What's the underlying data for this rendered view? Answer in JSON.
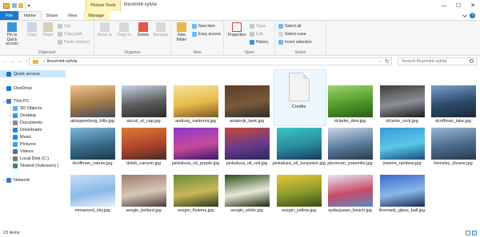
{
  "window": {
    "title": "linuxmint-sylvia",
    "context_tab": "Picture Tools",
    "controls": [
      "—",
      "☐",
      "✕"
    ]
  },
  "ribbon_tabs": [
    "File",
    "Home",
    "Share",
    "View",
    "Manage"
  ],
  "ribbon": {
    "clipboard": {
      "label": "Clipboard",
      "pin": "Pin to Quick access",
      "copy": "Copy",
      "paste": "Paste",
      "cut": "Cut",
      "copy_path": "Copy path",
      "paste_shortcut": "Paste shortcut"
    },
    "organize": {
      "label": "Organize",
      "move_to": "Move to",
      "copy_to": "Copy to",
      "delete": "Delete",
      "rename": "Rename"
    },
    "new": {
      "label": "New",
      "new_folder": "New folder",
      "new_item": "New item",
      "easy_access": "Easy access"
    },
    "open": {
      "label": "Open",
      "properties": "Properties",
      "open": "Open",
      "edit": "Edit",
      "history": "History"
    },
    "select": {
      "label": "Select",
      "select_all": "Select all",
      "select_none": "Select none",
      "invert": "Invert selection"
    }
  },
  "address": {
    "path": "linuxmint-sylvia",
    "search_placeholder": "Search linuxmint-sylvia"
  },
  "nav": [
    {
      "label": "Quick access",
      "color": "#1979ca",
      "indent": 0,
      "selected": true,
      "expand": "›"
    },
    {
      "label": "OneDrive",
      "color": "#1979ca",
      "indent": 0,
      "selected": false,
      "expand": "›"
    },
    {
      "label": "This PC",
      "color": "#3a7bbf",
      "indent": 0,
      "selected": false,
      "expand": "⌄"
    },
    {
      "label": "3D Objects",
      "color": "#6aa6e0",
      "indent": 1,
      "selected": false,
      "expand": "›"
    },
    {
      "label": "Desktop",
      "color": "#3c94d8",
      "indent": 1,
      "selected": false,
      "expand": "›"
    },
    {
      "label": "Documents",
      "color": "#8a8a8a",
      "indent": 1,
      "selected": false,
      "expand": "›"
    },
    {
      "label": "Downloads",
      "color": "#1e88d8",
      "indent": 1,
      "selected": false,
      "expand": "›"
    },
    {
      "label": "Music",
      "color": "#1e88d8",
      "indent": 1,
      "selected": false,
      "expand": "›"
    },
    {
      "label": "Pictures",
      "color": "#3aa0e6",
      "indent": 1,
      "selected": false,
      "expand": "›"
    },
    {
      "label": "Videos",
      "color": "#5a6e85",
      "indent": 1,
      "selected": false,
      "expand": "›"
    },
    {
      "label": "Local Disk (C:)",
      "color": "#6d7a88",
      "indent": 1,
      "selected": false,
      "expand": "›"
    },
    {
      "label": "Shared (\\\\vboxsrv) (",
      "color": "#3d8a3d",
      "indent": 1,
      "selected": false,
      "expand": "›"
    },
    {
      "label": "Network",
      "color": "#3a7bbf",
      "indent": 0,
      "selected": false,
      "expand": "›"
    }
  ],
  "files": [
    {
      "name": "akloppenburg_hills.jpg",
      "colors": [
        "#f2c48a",
        "#a37a4a",
        "#3e4b5a"
      ]
    },
    {
      "name": "akcoil_el_cap.jpg",
      "colors": [
        "#c8d6e6",
        "#5b5b5b",
        "#2a2a2a"
      ]
    },
    {
      "name": "andrzej_santorini.jpg",
      "colors": [
        "#f3e39a",
        "#e8b84a",
        "#7a5a2a"
      ]
    },
    {
      "name": "aviatorjk_bark.jpg",
      "colors": [
        "#5a3c2a",
        "#7a5a3a",
        "#2c2c2c"
      ]
    },
    {
      "name": "Credits",
      "colors": [],
      "doc": true
    },
    {
      "name": "dclarke_dew.jpg",
      "colors": [
        "#9ed36a",
        "#4f9a2a",
        "#2a5a1a"
      ]
    },
    {
      "name": "dclarke_rock.jpg",
      "colors": [
        "#3d3d3d",
        "#8a8f96",
        "#1a1a1a"
      ]
    },
    {
      "name": "dcoffman_lake.jpg",
      "colors": [
        "#7aa0c8",
        "#2c4a6a",
        "#1a2838"
      ]
    },
    {
      "name": "dcoffman_nature.jpg",
      "colors": [
        "#7fb8d8",
        "#3a6a8a",
        "#1a3a4a"
      ]
    },
    {
      "name": "dolah_canyon.jpg",
      "colors": [
        "#e07a3a",
        "#b0452a",
        "#4a2a2a"
      ]
    },
    {
      "name": "jankaluza_oil_purple.jpg",
      "colors": [
        "#8a3ac8",
        "#c84a9a",
        "#3a1a6a"
      ]
    },
    {
      "name": "jankaluza_oil_red.jpg",
      "colors": [
        "#c84a3a",
        "#6a3a8a",
        "#2a2a5a"
      ]
    },
    {
      "name": "jankaluza_oil_turquoise.jpg",
      "colors": [
        "#3ac8c0",
        "#2a8aa0",
        "#1a3a5a"
      ]
    },
    {
      "name": "jdonovan_yosemite.jpg",
      "colors": [
        "#c8d8e8",
        "#5a7a9a",
        "#2a3a4a"
      ]
    },
    {
      "name": "jowens_rainbow.jpg",
      "colors": [
        "#3a9ad8",
        "#5ac8e8",
        "#1a4a7a"
      ]
    },
    {
      "name": "kemsley_kluane.jpg",
      "colors": [
        "#9ab8d8",
        "#4a6a8a",
        "#2a3a4a"
      ]
    },
    {
      "name": "mmasood_sky.jpg",
      "colors": [
        "#c8e0f8",
        "#8ab8e8",
        "#e8f2fa"
      ]
    },
    {
      "name": "sezgin_bollard.jpg",
      "colors": [
        "#9a7a6a",
        "#d8c8b8",
        "#4a3a3a"
      ]
    },
    {
      "name": "sezgin_flowers.jpg",
      "colors": [
        "#6a8a3a",
        "#c8b85a",
        "#2a3a1a"
      ]
    },
    {
      "name": "sezgin_white.jpg",
      "colors": [
        "#2a4a1a",
        "#e8e8d8",
        "#1a2a0a"
      ]
    },
    {
      "name": "sezgin_yellow.jpg",
      "colors": [
        "#e8c83a",
        "#8a9a2a",
        "#3a4a1a"
      ]
    },
    {
      "name": "sydsujuaan_beach.jpg",
      "colors": [
        "#e8e8f0",
        "#c84a6a",
        "#5a8ac8"
      ]
    },
    {
      "name": "thomasb_glass_ball.jpg",
      "colors": [
        "#3a6ac8",
        "#8ab8e8",
        "#1a2a5a"
      ]
    }
  ],
  "status": {
    "count": "23 items"
  }
}
